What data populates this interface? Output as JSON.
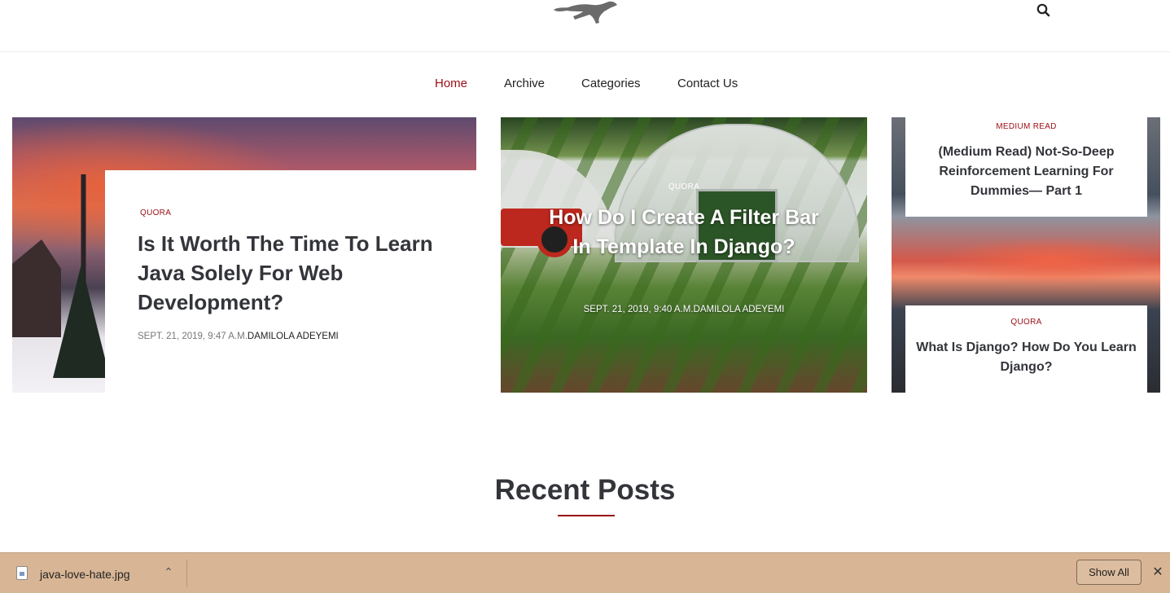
{
  "header": {
    "logo_icon": "running-cheetah-logo",
    "search_icon": "search-icon"
  },
  "nav": {
    "items": [
      {
        "label": "Home",
        "active": true
      },
      {
        "label": "Archive",
        "active": false
      },
      {
        "label": "Categories",
        "active": false
      },
      {
        "label": "Contact Us",
        "active": false
      }
    ]
  },
  "hero": {
    "main": {
      "category": "QUORA",
      "title": "Is It Worth The Time To Learn Java Solely For Web Development?",
      "date": "SEPT. 21, 2019, 9:47 A.M.",
      "author": "DAMILOLA ADEYEMI"
    },
    "center": {
      "category": "QUORA",
      "title": "How Do I Create A Filter Bar In Template In Django?",
      "date": "SEPT. 21, 2019, 9:40 A.M.",
      "author": "DAMILOLA ADEYEMI"
    },
    "side": [
      {
        "category": "MEDIUM READ",
        "title": "(Medium Read) Not-So-Deep Reinforcement Learning For Dummies— Part 1"
      },
      {
        "category": "QUORA",
        "title": "What Is Django? How Do You Learn Django?"
      }
    ]
  },
  "recent": {
    "heading": "Recent Posts"
  },
  "download_bar": {
    "file_name": "java-love-hate.jpg",
    "show_all_label": "Show All",
    "chevron": "⌃",
    "close": "✕"
  },
  "colors": {
    "accent": "#9b0d15",
    "download_bar_bg": "#d8b595"
  }
}
